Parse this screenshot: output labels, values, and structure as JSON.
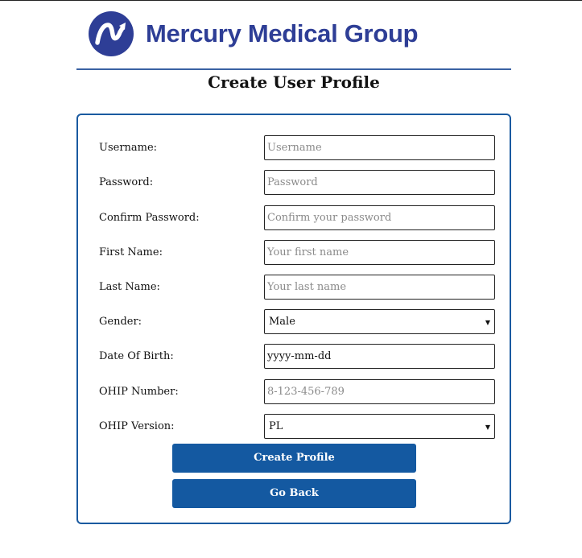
{
  "brand": {
    "name": "Mercury Medical Group",
    "logo_icon": "mercury-logo-icon",
    "color": "#2e3e96"
  },
  "page": {
    "title": "Create User Profile",
    "accent_color": "#1459a1"
  },
  "form": {
    "username": {
      "label": "Username:",
      "placeholder": "Username"
    },
    "password": {
      "label": "Password:",
      "placeholder": "Password"
    },
    "confirm_password": {
      "label": "Confirm Password:",
      "placeholder": "Confirm your password"
    },
    "first_name": {
      "label": "First Name:",
      "placeholder": "Your first name"
    },
    "last_name": {
      "label": "Last Name:",
      "placeholder": "Your last name"
    },
    "gender": {
      "label": "Gender:",
      "value": "Male",
      "icon": "dropdown-arrow-icon"
    },
    "date_of_birth": {
      "label": "Date Of Birth:",
      "value": "yyyy-mm-dd"
    },
    "ohip_number": {
      "label": "OHIP Number:",
      "placeholder": "8-123-456-789"
    },
    "ohip_version": {
      "label": "OHIP Version:",
      "value": "PL",
      "icon": "dropdown-arrow-icon"
    }
  },
  "buttons": {
    "create": "Create Profile",
    "back": "Go Back"
  }
}
